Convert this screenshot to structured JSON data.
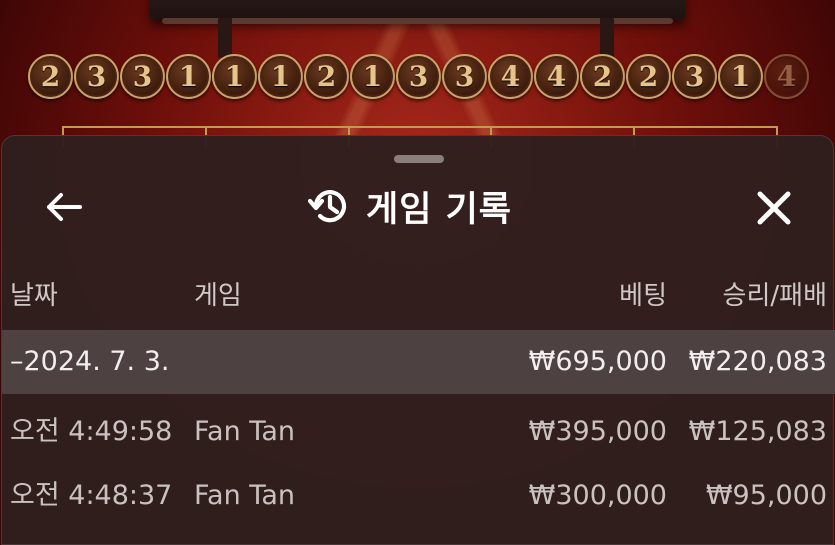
{
  "beads": [
    "2",
    "3",
    "3",
    "1",
    "1",
    "1",
    "2",
    "1",
    "3",
    "3",
    "4",
    "4",
    "2",
    "2",
    "3",
    "1",
    "4"
  ],
  "header": {
    "title": "게임 기록",
    "back_icon": "back-arrow-icon",
    "title_icon": "history-icon",
    "close_icon": "close-icon"
  },
  "table": {
    "columns": {
      "date": "날짜",
      "game": "게임",
      "bet": "베팅",
      "result": "승리/패배"
    },
    "group": {
      "label": "–2024. 7. 3.",
      "bet": "₩695,000",
      "result": "₩220,083"
    },
    "rows": [
      {
        "time": "오전 4:49:58",
        "game": "Fan Tan",
        "bet": "₩395,000",
        "result": "₩125,083"
      },
      {
        "time": "오전 4:48:37",
        "game": "Fan Tan",
        "bet": "₩300,000",
        "result": "₩95,000"
      }
    ]
  },
  "colors": {
    "sheet": "#2f1f1e",
    "group_row": "#4d4141",
    "bead_border": "#c8a46a",
    "background": "#6e0f0a"
  }
}
